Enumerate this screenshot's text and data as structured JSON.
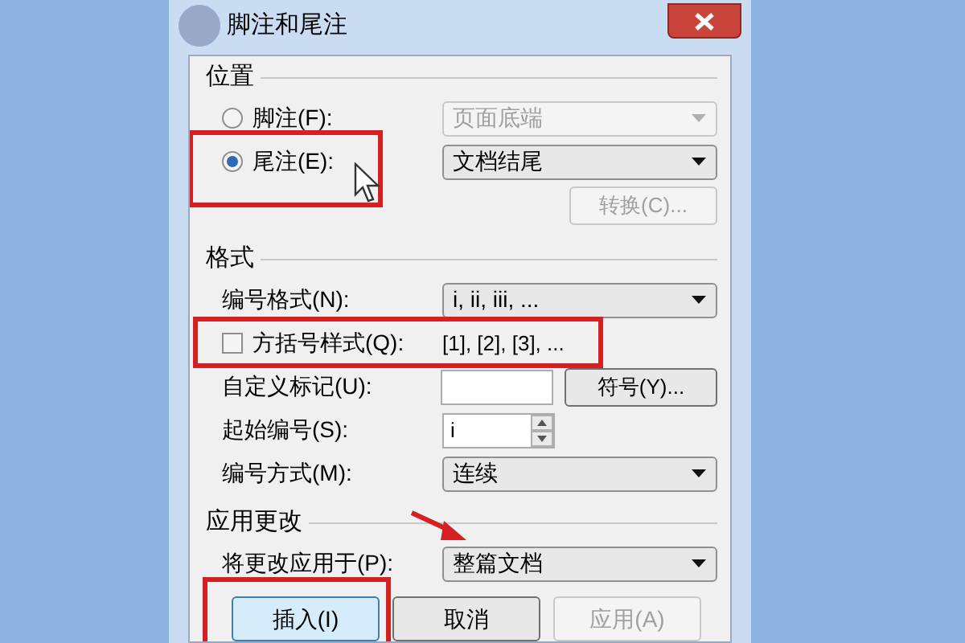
{
  "window": {
    "title": "脚注和尾注"
  },
  "sections": [
    {
      "title": "位置",
      "rows": [
        {
          "kind": "radio",
          "label": "脚注(F):",
          "selected": false,
          "control": {
            "kind": "dropdown",
            "value": "页面底端",
            "disabled": true
          }
        },
        {
          "kind": "radio",
          "label": "尾注(E):",
          "selected": true,
          "highlighted": true,
          "control": {
            "kind": "dropdown",
            "value": "文档结尾",
            "disabled": false
          }
        },
        {
          "kind": "plain",
          "control": {
            "kind": "button",
            "label": "转换(C)...",
            "disabled": true
          }
        }
      ]
    },
    {
      "title": "格式",
      "rows": [
        {
          "kind": "label",
          "label": "编号格式(N):",
          "control": {
            "kind": "dropdown",
            "value": "i, ii, iii, ...",
            "disabled": false
          }
        },
        {
          "kind": "checkbox",
          "label": "方括号样式(Q):",
          "checked": false,
          "highlighted": true,
          "control": {
            "kind": "text",
            "value": "[1], [2], [3], ..."
          }
        },
        {
          "kind": "label",
          "label": "自定义标记(U):",
          "control": {
            "kind": "field-button",
            "button": "符号(Y)..."
          }
        },
        {
          "kind": "label",
          "label": "起始编号(S):",
          "control": {
            "kind": "spinner",
            "value": "i"
          }
        },
        {
          "kind": "label",
          "label": "编号方式(M):",
          "control": {
            "kind": "dropdown",
            "value": "连续",
            "disabled": false
          }
        }
      ]
    },
    {
      "title": "应用更改",
      "rows": [
        {
          "kind": "label",
          "label": "将更改应用于(P):",
          "control": {
            "kind": "dropdown",
            "value": "整篇文档",
            "disabled": false,
            "pointed_at": true
          }
        }
      ]
    }
  ],
  "buttons": [
    {
      "label": "插入(I)",
      "default": true,
      "disabled": false,
      "highlighted": true
    },
    {
      "label": "取消",
      "default": false,
      "disabled": false,
      "highlighted": false
    },
    {
      "label": "应用(A)",
      "default": false,
      "disabled": true,
      "highlighted": false
    }
  ]
}
